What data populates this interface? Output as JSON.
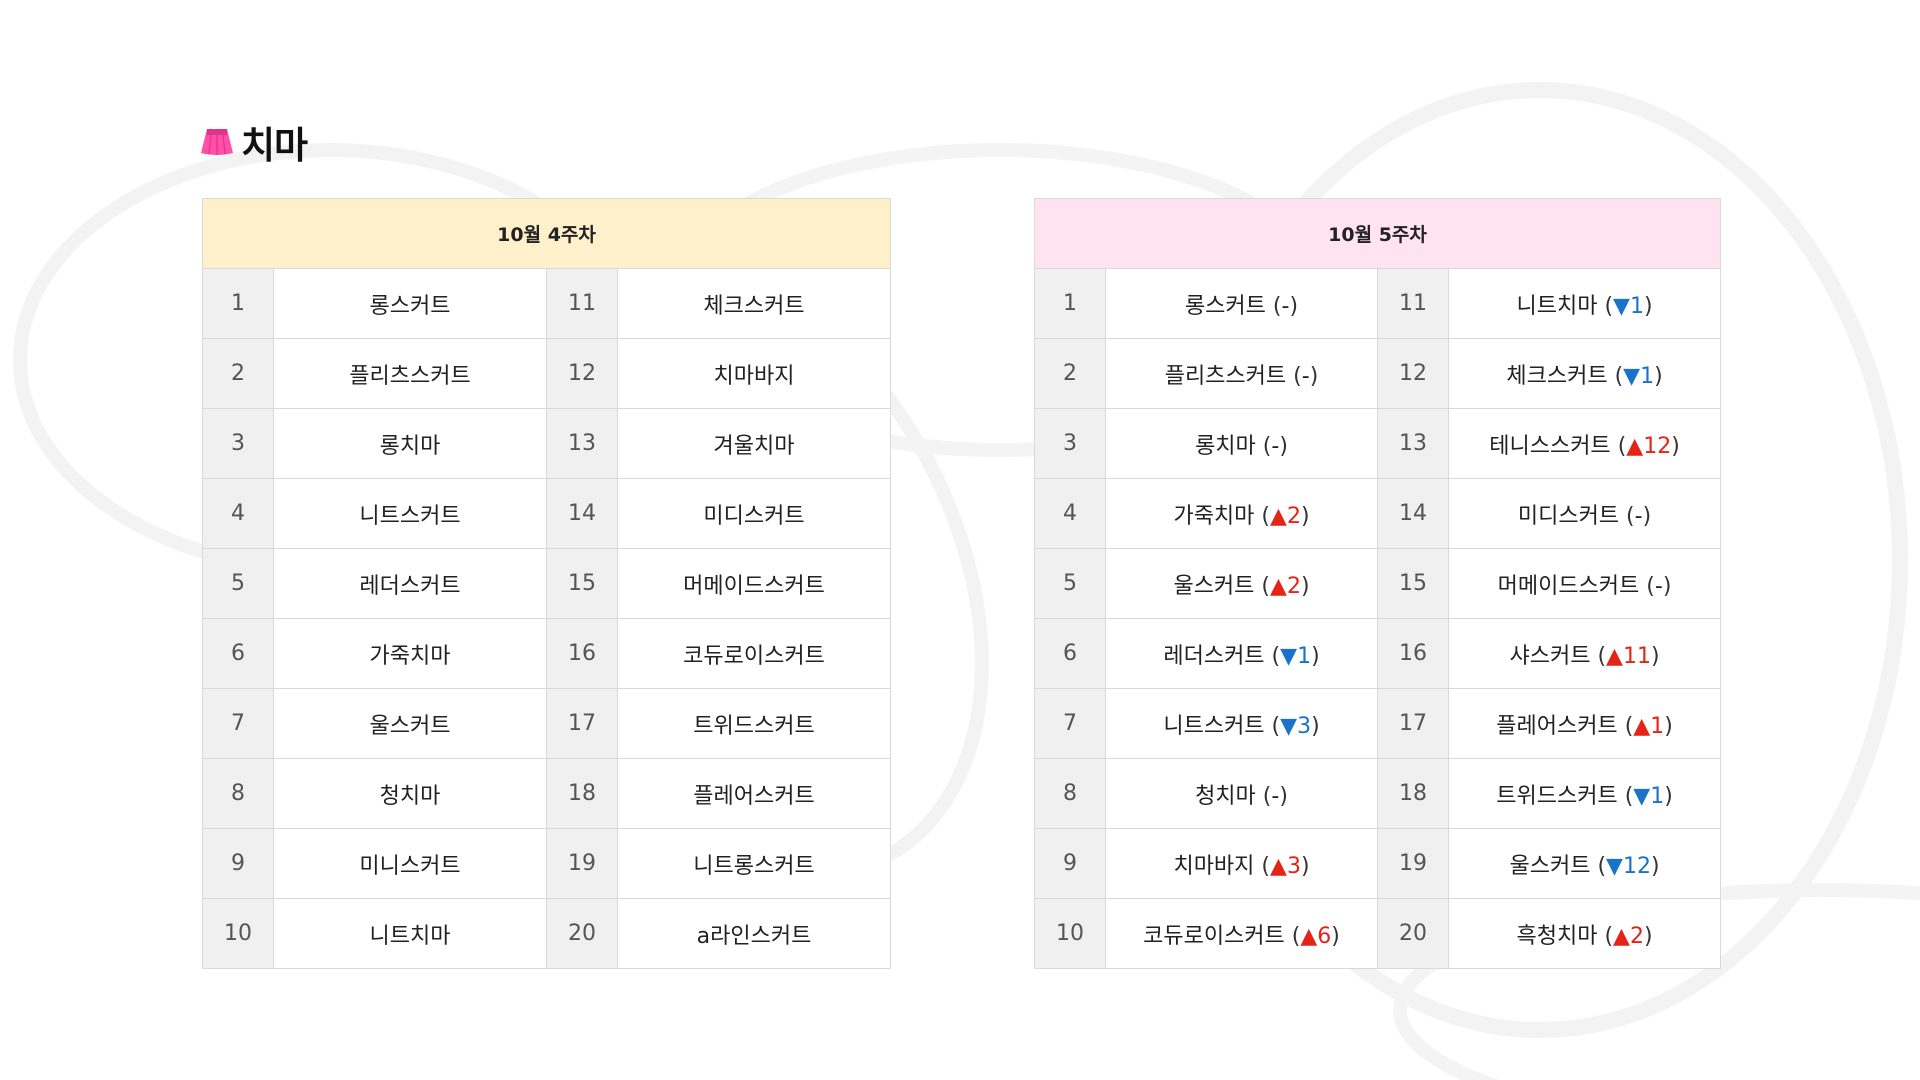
{
  "page": {
    "title": "치마",
    "icon": "skirt-icon",
    "accent_color": "#ff4fa8"
  },
  "colors": {
    "header_week4": "#fff0cc",
    "header_week5": "#ffe3ef",
    "rank_up": "#e32417",
    "rank_down": "#1a73c9"
  },
  "week4": {
    "header": "10월 4주차",
    "rows": [
      {
        "rank_a": "1",
        "item_a": "롱스커트",
        "rank_b": "11",
        "item_b": "체크스커트"
      },
      {
        "rank_a": "2",
        "item_a": "플리츠스커트",
        "rank_b": "12",
        "item_b": "치마바지"
      },
      {
        "rank_a": "3",
        "item_a": "롱치마",
        "rank_b": "13",
        "item_b": "겨울치마"
      },
      {
        "rank_a": "4",
        "item_a": "니트스커트",
        "rank_b": "14",
        "item_b": "미디스커트"
      },
      {
        "rank_a": "5",
        "item_a": "레더스커트",
        "rank_b": "15",
        "item_b": "머메이드스커트"
      },
      {
        "rank_a": "6",
        "item_a": "가죽치마",
        "rank_b": "16",
        "item_b": "코듀로이스커트"
      },
      {
        "rank_a": "7",
        "item_a": "울스커트",
        "rank_b": "17",
        "item_b": "트위드스커트"
      },
      {
        "rank_a": "8",
        "item_a": "청치마",
        "rank_b": "18",
        "item_b": "플레어스커트"
      },
      {
        "rank_a": "9",
        "item_a": "미니스커트",
        "rank_b": "19",
        "item_b": "니트롱스커트"
      },
      {
        "rank_a": "10",
        "item_a": "니트치마",
        "rank_b": "20",
        "item_b": "a라인스커트"
      }
    ]
  },
  "week5": {
    "header": "10월 5주차",
    "rows": [
      {
        "rank_a": "1",
        "item_a": "롱스커트",
        "change_a": "-",
        "dir_a": "none",
        "rank_b": "11",
        "item_b": "니트치마",
        "change_b": "1",
        "dir_b": "down"
      },
      {
        "rank_a": "2",
        "item_a": "플리츠스커트",
        "change_a": "-",
        "dir_a": "none",
        "rank_b": "12",
        "item_b": "체크스커트",
        "change_b": "1",
        "dir_b": "down"
      },
      {
        "rank_a": "3",
        "item_a": "롱치마",
        "change_a": "-",
        "dir_a": "none",
        "rank_b": "13",
        "item_b": "테니스스커트",
        "change_b": "12",
        "dir_b": "up"
      },
      {
        "rank_a": "4",
        "item_a": "가죽치마",
        "change_a": "2",
        "dir_a": "up",
        "rank_b": "14",
        "item_b": "미디스커트",
        "change_b": "-",
        "dir_b": "none"
      },
      {
        "rank_a": "5",
        "item_a": "울스커트",
        "change_a": "2",
        "dir_a": "up",
        "rank_b": "15",
        "item_b": "머메이드스커트",
        "change_b": "-",
        "dir_b": "none"
      },
      {
        "rank_a": "6",
        "item_a": "레더스커트",
        "change_a": "1",
        "dir_a": "down",
        "rank_b": "16",
        "item_b": "샤스커트",
        "change_b": "11",
        "dir_b": "up"
      },
      {
        "rank_a": "7",
        "item_a": "니트스커트",
        "change_a": "3",
        "dir_a": "down",
        "rank_b": "17",
        "item_b": "플레어스커트",
        "change_b": "1",
        "dir_b": "up"
      },
      {
        "rank_a": "8",
        "item_a": "청치마",
        "change_a": "-",
        "dir_a": "none",
        "rank_b": "18",
        "item_b": "트위드스커트",
        "change_b": "1",
        "dir_b": "down"
      },
      {
        "rank_a": "9",
        "item_a": "치마바지",
        "change_a": "3",
        "dir_a": "up",
        "rank_b": "19",
        "item_b": "울스커트",
        "change_b": "12",
        "dir_b": "down"
      },
      {
        "rank_a": "10",
        "item_a": "코듀로이스커트",
        "change_a": "6",
        "dir_a": "up",
        "rank_b": "20",
        "item_b": "흑청치마",
        "change_b": "2",
        "dir_b": "up"
      }
    ]
  }
}
